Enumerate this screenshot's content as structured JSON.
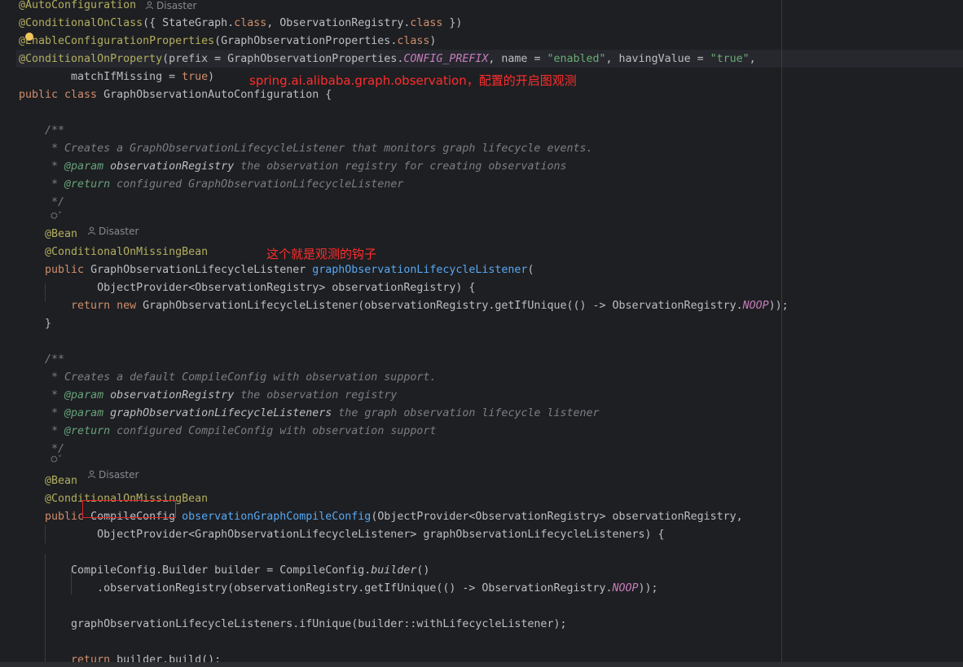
{
  "editor": {
    "language": "java",
    "author_hint": "Disaster",
    "lines": [
      {
        "segments": [
          {
            "t": "@AutoConfiguration",
            "c": "ann"
          }
        ]
      },
      {
        "segments": [
          {
            "t": "@ConditionalOnClass",
            "c": "ann"
          },
          {
            "t": "({ StateGraph.",
            "c": ""
          },
          {
            "t": "class",
            "c": "kw"
          },
          {
            "t": ", ObservationRegistry.",
            "c": ""
          },
          {
            "t": "class",
            "c": "kw"
          },
          {
            "t": " })",
            "c": ""
          }
        ]
      },
      {
        "segments": [
          {
            "t": "@EnableConfigurationProperties",
            "c": "ann"
          },
          {
            "t": "(GraphObservationProperties.",
            "c": ""
          },
          {
            "t": "class",
            "c": "kw"
          },
          {
            "t": ")",
            "c": ""
          }
        ]
      },
      {
        "segments": [
          {
            "t": "@ConditionalOnProperty",
            "c": "ann"
          },
          {
            "t": "(prefix = GraphObservationProperties.",
            "c": ""
          },
          {
            "t": "CONFIG_PREFIX",
            "c": "const"
          },
          {
            "t": ", name = ",
            "c": ""
          },
          {
            "t": "\"enabled\"",
            "c": "str"
          },
          {
            "t": ", havingValue = ",
            "c": ""
          },
          {
            "t": "\"true\"",
            "c": "str"
          },
          {
            "t": ",",
            "c": ""
          }
        ]
      },
      {
        "segments": [
          {
            "t": "        matchIfMissing = ",
            "c": ""
          },
          {
            "t": "true",
            "c": "kw"
          },
          {
            "t": ")",
            "c": ""
          }
        ]
      },
      {
        "segments": [
          {
            "t": "public class ",
            "c": "kw"
          },
          {
            "t": "GraphObservationAutoConfiguration {",
            "c": ""
          }
        ]
      },
      {
        "segments": []
      },
      {
        "segments": [
          {
            "t": "    /**",
            "c": "cmt"
          }
        ]
      },
      {
        "segments": [
          {
            "t": "     * Creates a GraphObservationLifecycleListener that monitors graph lifecycle events.",
            "c": "cmt"
          }
        ]
      },
      {
        "segments": [
          {
            "t": "     * ",
            "c": "cmt"
          },
          {
            "t": "@param",
            "c": "doctag"
          },
          {
            "t": " observationRegistry",
            "c": "docparam"
          },
          {
            "t": " the observation registry for creating observations",
            "c": "cmt"
          }
        ]
      },
      {
        "segments": [
          {
            "t": "     * ",
            "c": "cmt"
          },
          {
            "t": "@return",
            "c": "doctag"
          },
          {
            "t": " configured GraphObservationLifecycleListener",
            "c": "cmt"
          }
        ]
      },
      {
        "segments": [
          {
            "t": "     */",
            "c": "cmt"
          }
        ]
      },
      {
        "segments": [
          {
            "t": "    @Bean",
            "c": "ann"
          }
        ]
      },
      {
        "segments": [
          {
            "t": "    @ConditionalOnMissingBean",
            "c": "ann"
          }
        ]
      },
      {
        "segments": [
          {
            "t": "    public ",
            "c": "kw"
          },
          {
            "t": "GraphObservationLifecycleListener ",
            "c": ""
          },
          {
            "t": "graphObservationLifecycleListener",
            "c": "fn"
          },
          {
            "t": "(",
            "c": ""
          }
        ]
      },
      {
        "segments": [
          {
            "t": "            ObjectProvider<ObservationRegistry> observationRegistry) {",
            "c": ""
          }
        ]
      },
      {
        "segments": [
          {
            "t": "        return new ",
            "c": "kw"
          },
          {
            "t": "GraphObservationLifecycleListener(observationRegistry.getIfUnique(() -> ObservationRegistry.",
            "c": ""
          },
          {
            "t": "NOOP",
            "c": "const"
          },
          {
            "t": "));",
            "c": ""
          }
        ]
      },
      {
        "segments": [
          {
            "t": "    }",
            "c": ""
          }
        ]
      },
      {
        "segments": []
      },
      {
        "segments": [
          {
            "t": "    /**",
            "c": "cmt"
          }
        ]
      },
      {
        "segments": [
          {
            "t": "     * Creates a default CompileConfig with observation support.",
            "c": "cmt"
          }
        ]
      },
      {
        "segments": [
          {
            "t": "     * ",
            "c": "cmt"
          },
          {
            "t": "@param",
            "c": "doctag"
          },
          {
            "t": " observationRegistry",
            "c": "docparam"
          },
          {
            "t": " the observation registry",
            "c": "cmt"
          }
        ]
      },
      {
        "segments": [
          {
            "t": "     * ",
            "c": "cmt"
          },
          {
            "t": "@param",
            "c": "doctag"
          },
          {
            "t": " graphObservationLifecycleListeners",
            "c": "docparam"
          },
          {
            "t": " the graph observation lifecycle listener",
            "c": "cmt"
          }
        ]
      },
      {
        "segments": [
          {
            "t": "     * ",
            "c": "cmt"
          },
          {
            "t": "@return",
            "c": "doctag"
          },
          {
            "t": " configured CompileConfig with observation support",
            "c": "cmt"
          }
        ]
      },
      {
        "segments": [
          {
            "t": "     */",
            "c": "cmt"
          }
        ]
      },
      {
        "segments": [
          {
            "t": "    @Bean",
            "c": "ann"
          }
        ]
      },
      {
        "segments": [
          {
            "t": "    @ConditionalOnMissingBean",
            "c": "ann"
          }
        ]
      },
      {
        "segments": [
          {
            "t": "    public ",
            "c": "kw"
          },
          {
            "t": "CompileConfig ",
            "c": ""
          },
          {
            "t": "observationGraphCompileConfig",
            "c": "fn"
          },
          {
            "t": "(ObjectProvider<ObservationRegistry> observationRegistry,",
            "c": ""
          }
        ]
      },
      {
        "segments": [
          {
            "t": "            ObjectProvider<GraphObservationLifecycleListener> graphObservationLifecycleListeners) {",
            "c": ""
          }
        ]
      },
      {
        "segments": []
      },
      {
        "segments": [
          {
            "t": "        CompileConfig.Builder builder = CompileConfig.",
            "c": ""
          },
          {
            "t": "builder",
            "c": "static-call"
          },
          {
            "t": "()",
            "c": ""
          }
        ]
      },
      {
        "segments": [
          {
            "t": "            .observationRegistry(observationRegistry.getIfUnique(() -> ObservationRegistry.",
            "c": ""
          },
          {
            "t": "NOOP",
            "c": "const"
          },
          {
            "t": "));",
            "c": ""
          }
        ]
      },
      {
        "segments": []
      },
      {
        "segments": [
          {
            "t": "        graphObservationLifecycleListeners.ifUnique(builder::withLifecycleListener);",
            "c": ""
          }
        ]
      },
      {
        "segments": []
      },
      {
        "segments": [
          {
            "t": "        return ",
            "c": "kw"
          },
          {
            "t": "builder.build();",
            "c": ""
          }
        ]
      }
    ]
  },
  "fold_hint": "⛭˅",
  "callouts": {
    "observation_prefix": "spring.ai.alibaba.graph.observation，配置的开启图观测",
    "hook": "这个就是观测的钩子"
  },
  "colors": {
    "background": "#1e1f22",
    "annotation": "#b3ae60",
    "keyword": "#cf8e6d",
    "string": "#6aab73",
    "method": "#56a8f5",
    "constant": "#c77dbb",
    "comment": "#7a7e85",
    "callout": "#ff2d2d"
  }
}
